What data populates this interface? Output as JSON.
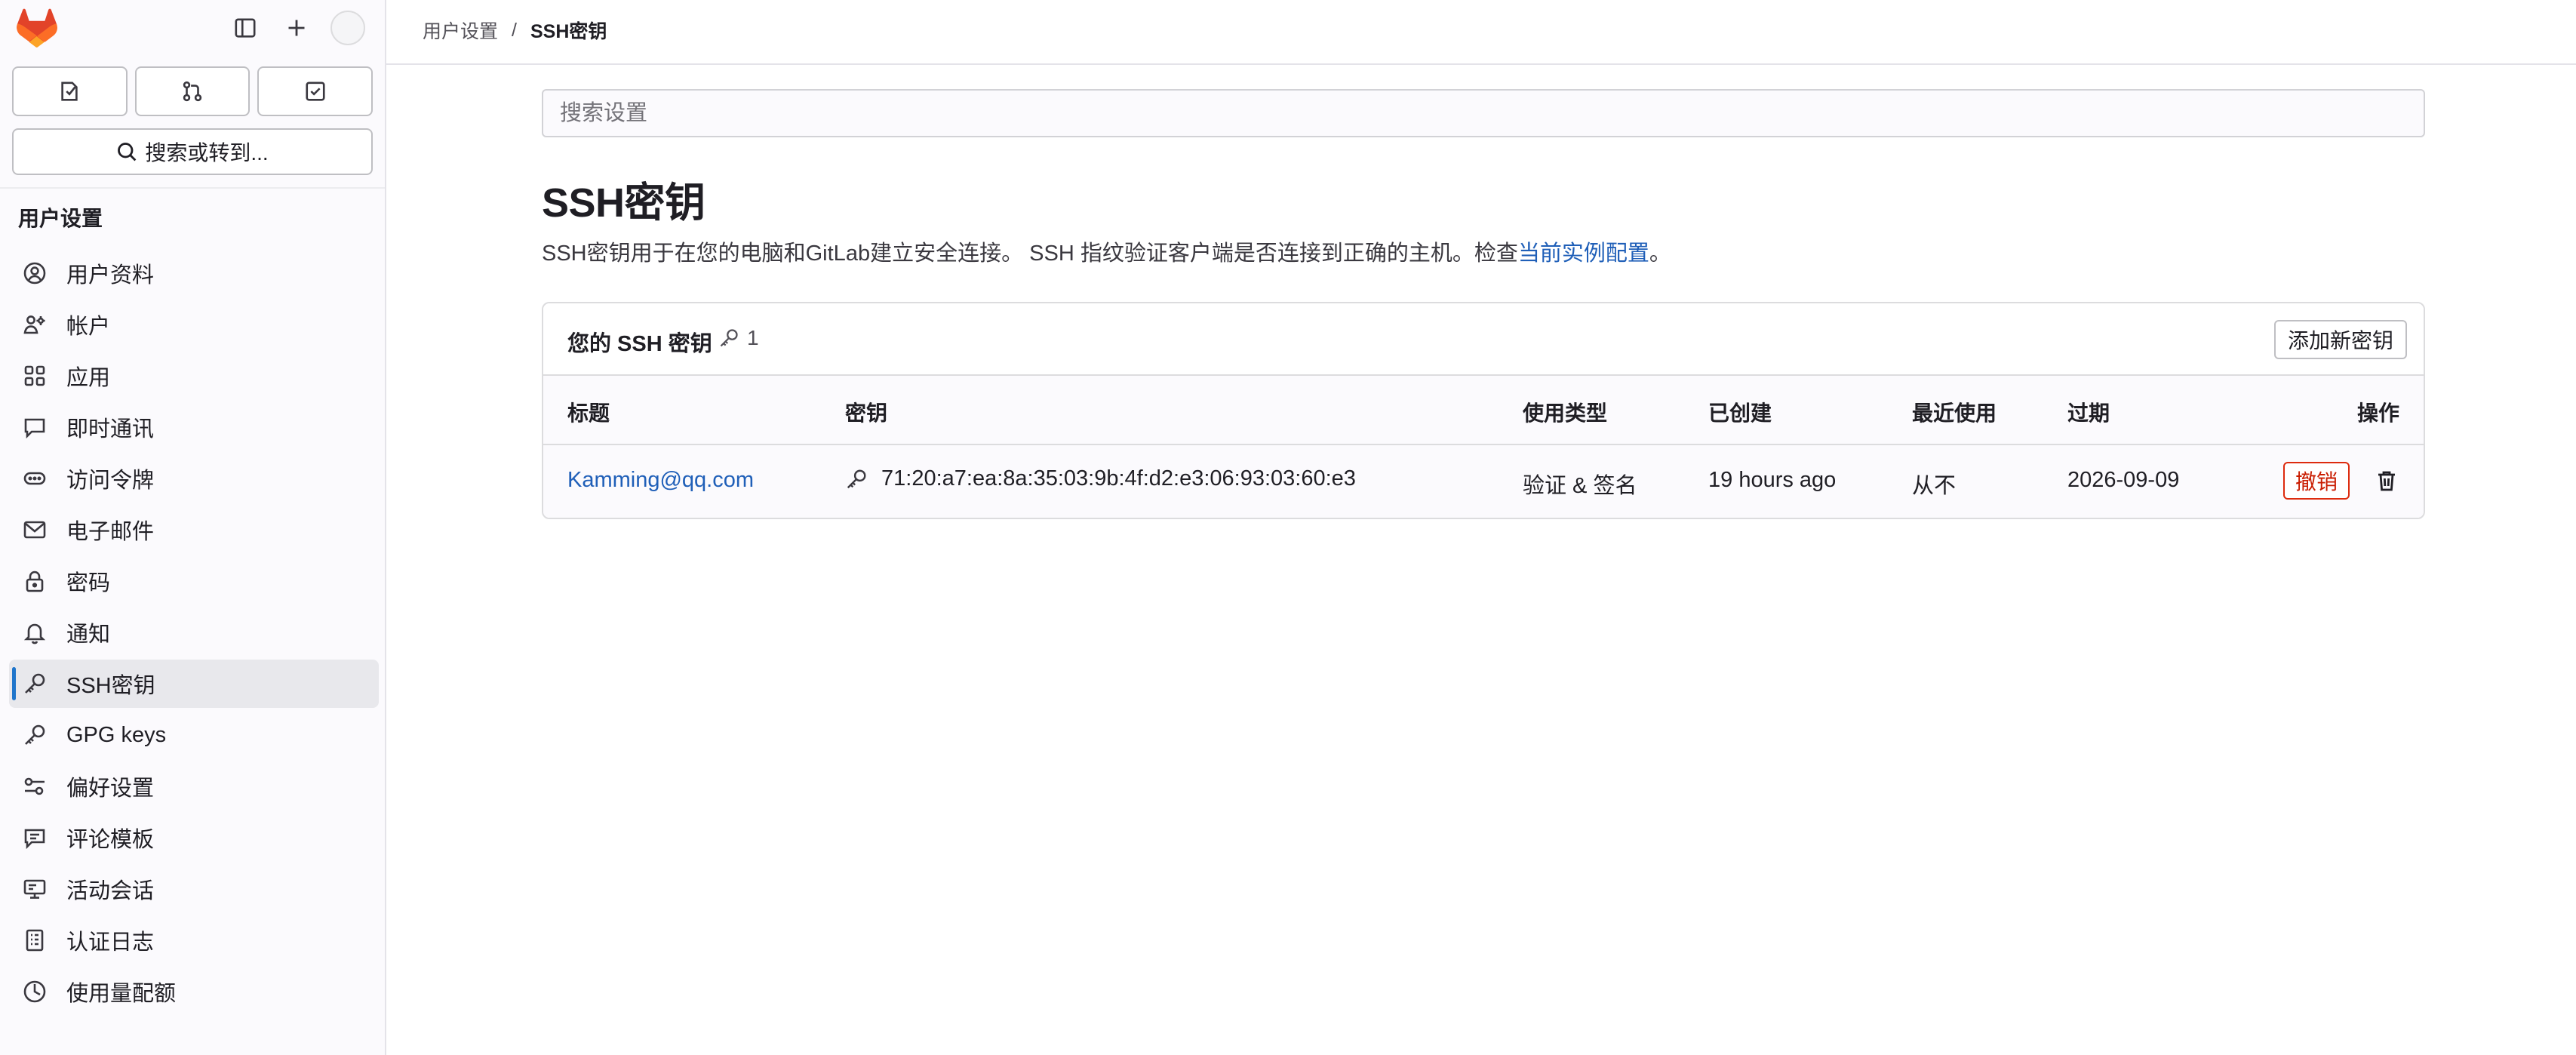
{
  "sidebar": {
    "search_label": "搜索或转到...",
    "heading": "用户设置",
    "items": [
      {
        "label": "用户资料",
        "icon": "profile-icon"
      },
      {
        "label": "帐户",
        "icon": "account-icon"
      },
      {
        "label": "应用",
        "icon": "applications-icon"
      },
      {
        "label": "即时通讯",
        "icon": "comment-icon"
      },
      {
        "label": "访问令牌",
        "icon": "token-icon"
      },
      {
        "label": "电子邮件",
        "icon": "mail-icon"
      },
      {
        "label": "密码",
        "icon": "lock-icon"
      },
      {
        "label": "通知",
        "icon": "bell-icon"
      },
      {
        "label": "SSH密钥",
        "icon": "key-icon",
        "active": true
      },
      {
        "label": "GPG keys",
        "icon": "key-icon"
      },
      {
        "label": "偏好设置",
        "icon": "preferences-icon"
      },
      {
        "label": "评论模板",
        "icon": "comment-template-icon"
      },
      {
        "label": "活动会话",
        "icon": "monitor-icon"
      },
      {
        "label": "认证日志",
        "icon": "log-icon"
      },
      {
        "label": "使用量配额",
        "icon": "quota-icon"
      }
    ]
  },
  "breadcrumb": {
    "parent": "用户设置",
    "separator": "/",
    "current": "SSH密钥"
  },
  "main": {
    "search_placeholder": "搜索设置",
    "title": "SSH密钥",
    "description": "SSH密钥用于在您的电脑和GitLab建立安全连接。 SSH 指纹验证客户端是否连接到正确的主机。检查",
    "description_link": "当前实例配置",
    "description_end": "。",
    "card": {
      "title": "您的 SSH 密钥",
      "count": "1",
      "add_button": "添加新密钥",
      "columns": {
        "title": "标题",
        "key": "密钥",
        "usage": "使用类型",
        "created": "已创建",
        "last_used": "最近使用",
        "expires": "过期",
        "actions": "操作"
      },
      "rows": [
        {
          "title": "Kamming@qq.com",
          "fingerprint": "71:20:a7:ea:8a:35:03:9b:4f:d2:e3:06:93:03:60:e3",
          "usage": "验证 & 签名",
          "created": "19 hours ago",
          "last_used": "从不",
          "expires": "2026-09-09",
          "revoke_label": "撤销"
        }
      ]
    }
  },
  "colors": {
    "accent": "#1f75cb",
    "link": "#1f5fb8",
    "danger": "#dd2b0e",
    "logo_orange": "#e24329"
  }
}
